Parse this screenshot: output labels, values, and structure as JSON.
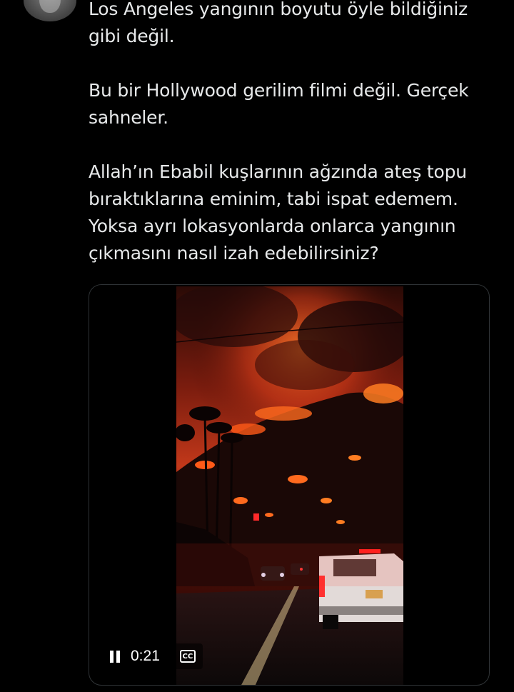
{
  "tweet": {
    "paragraphs": [
      "Los Angeles yangının boyutu öyle bildiğiniz gibi değil.",
      "Bu bir Hollywood gerilim filmi değil. Gerçek sahneler.",
      "Allah’ın Ebabil kuşlarının ağzında ateş topu bıraktıklarına eminim, tabi ispat edemem. Yoksa ayrı lokasyonlarda onlarca yangının çıkmasını nasıl izah edebilirsiniz?"
    ]
  },
  "video": {
    "time": "0:21",
    "cc_label": "CC",
    "state": "playing"
  },
  "colors": {
    "background": "#000000",
    "text": "#e7e9ea",
    "border": "#2f3336",
    "fire": "#ff4a1a"
  },
  "icons": {
    "pause": "pause-icon",
    "captions": "closed-captions-icon"
  }
}
